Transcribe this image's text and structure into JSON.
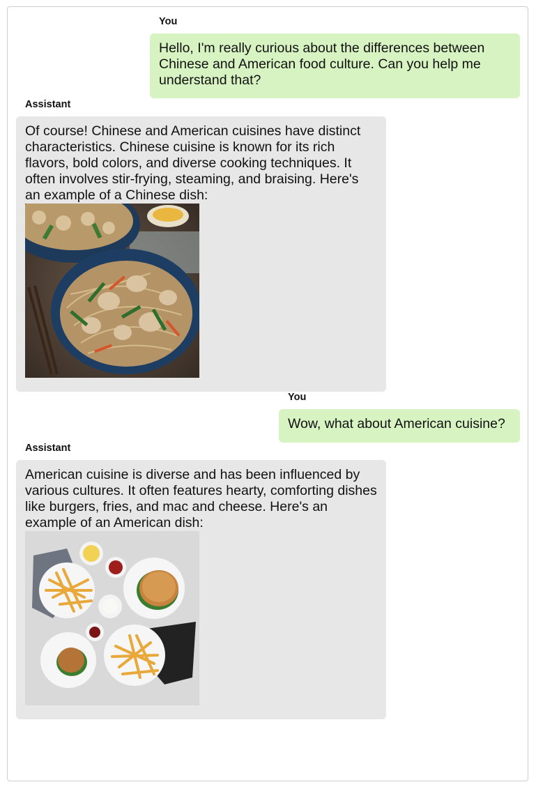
{
  "messages": [
    {
      "sender": "You",
      "text": "Hello, I'm really curious about the differences between Chinese and American food culture. Can you help me understand that?"
    },
    {
      "sender": "Assistant",
      "text": "Of course! Chinese and American cuisines have distinct characteristics. Chinese cuisine is known for its rich flavors, bold colors, and diverse cooking techniques. It often involves stir-frying, steaming, and braising. Here's an example of a Chinese dish:",
      "image": "chinese-noodle-stir-fry-image"
    },
    {
      "sender": "You",
      "text": "Wow, what about American cuisine?"
    },
    {
      "sender": "Assistant",
      "text": "American cuisine is diverse and has been influenced by various cultures. It often features hearty, comforting dishes like burgers, fries, and mac and cheese. Here's an example of an American dish:",
      "image": "burgers-and-fries-image"
    }
  ],
  "colors": {
    "user_bubble": "#d8f3c2",
    "assistant_bubble": "#e7e7e7"
  }
}
